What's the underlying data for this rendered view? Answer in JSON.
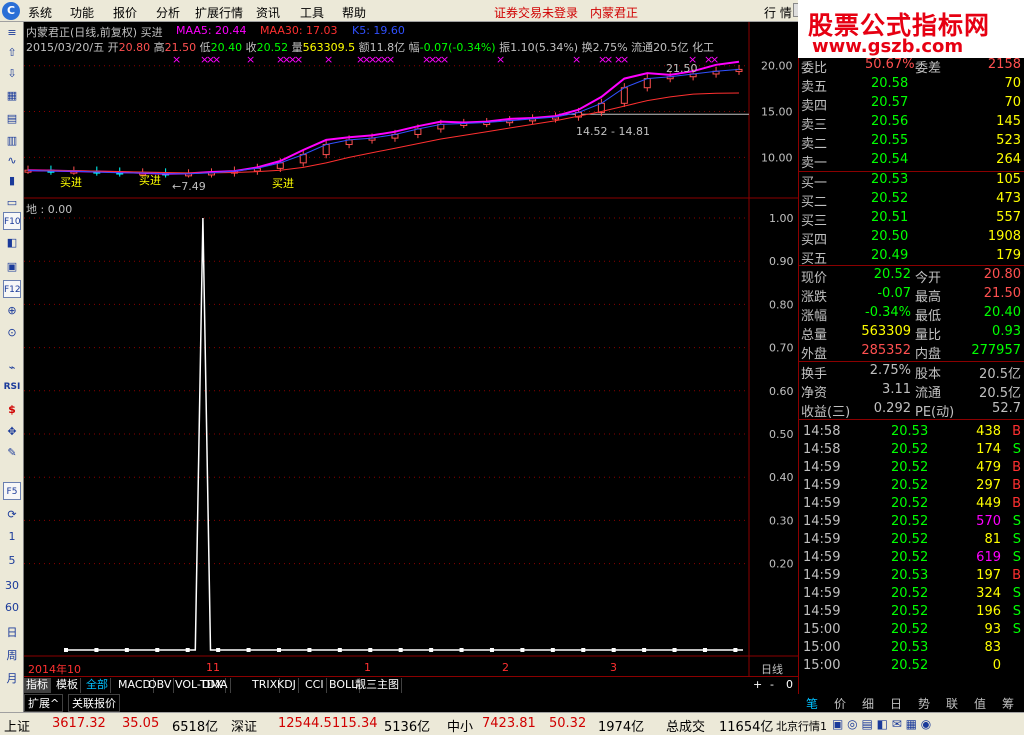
{
  "menu": {
    "items": [
      "系统",
      "功能",
      "报价",
      "分析",
      "扩展行情",
      "资讯",
      "工具",
      "帮助"
    ],
    "notice": "证券交易未登录",
    "stock": "内蒙君正",
    "right_label": "行 情"
  },
  "logo": {
    "title": "股票公式指标网",
    "url": "www.gszb.com"
  },
  "chart_header": {
    "title": "内蒙君正(日线,前复权) 买进",
    "ma5_label": "MAA5: 20.44",
    "ma30_label": "MAA30: 17.03",
    "k5_label": "K5: 19.60",
    "info_date": "2015/03/20/五",
    "open_label": "开",
    "open": "20.80",
    "high_label": "高",
    "high": "21.50",
    "low_label": "低",
    "low": "20.40",
    "close_label": "收",
    "close": "20.52",
    "vol_label": "量",
    "vol": "563309.5",
    "amount_label": "额",
    "amount": "11.8亿",
    "range_label": "幅",
    "range": "-0.07(-0.34%)",
    "amp_label": "振",
    "amp": "1.10(5.34%)",
    "turnover_label": "换",
    "turnover": "2.75%",
    "float_label": "流通",
    "float": "20.5亿",
    "industry": "化工"
  },
  "chart_annotations": {
    "buy1": "买进",
    "buy2": "买进",
    "buy3": "买进",
    "low_price": "7.49",
    "high_price": "21.50",
    "range": "14.52 - 14.81"
  },
  "sub_header": "地 : 0.00",
  "x_axis": [
    "2014年10",
    "11",
    "1",
    "2",
    "3"
  ],
  "x_axis_right": "日线",
  "chart_data": [
    {
      "type": "line",
      "title": "内蒙君正(日线,前复权)",
      "y_ticks": [
        "20.00",
        "15.00",
        "10.00"
      ],
      "ylim": [
        6,
        21.5
      ],
      "series": [
        {
          "name": "MAA5",
          "color": "#ff00ff",
          "values": [
            8.6,
            8.55,
            8.5,
            8.45,
            8.4,
            8.3,
            8.2,
            8.25,
            8.4,
            8.5,
            8.9,
            9.6,
            10.8,
            11.9,
            12.2,
            12.4,
            12.8,
            13.4,
            13.9,
            13.8,
            13.9,
            14.2,
            14.3,
            14.5,
            15.2,
            16.6,
            18.6,
            19.2,
            19.0,
            19.4,
            20.1,
            20.44
          ]
        },
        {
          "name": "MAA30",
          "color": "#ff3030",
          "values": [
            8.6,
            8.58,
            8.55,
            8.5,
            8.45,
            8.4,
            8.35,
            8.3,
            8.3,
            8.35,
            8.45,
            8.6,
            8.9,
            9.4,
            10.0,
            10.5,
            11.0,
            11.5,
            12.0,
            12.4,
            12.8,
            13.2,
            13.6,
            14.0,
            14.5,
            15.0,
            15.6,
            16.2,
            16.6,
            16.9,
            17.0,
            17.03
          ]
        },
        {
          "name": "K5",
          "color": "#3050ff",
          "values": [
            8.6,
            8.5,
            8.5,
            8.4,
            8.3,
            8.3,
            8.2,
            8.2,
            8.3,
            8.5,
            8.8,
            9.4,
            10.3,
            11.4,
            11.9,
            12.1,
            12.5,
            13.1,
            13.6,
            13.7,
            13.8,
            14.0,
            14.2,
            14.4,
            14.9,
            15.9,
            17.6,
            18.6,
            18.8,
            19.1,
            19.4,
            19.6
          ]
        }
      ]
    },
    {
      "type": "line",
      "title": "地",
      "y_ticks": [
        "1.00",
        "0.90",
        "0.80",
        "0.70",
        "0.60",
        "0.50",
        "0.40",
        "0.30",
        "0.20"
      ],
      "ylim": [
        0,
        1
      ],
      "series": [
        {
          "name": "地",
          "color": "#ffffff",
          "values": [
            0,
            0,
            0,
            0,
            0,
            0,
            0,
            0,
            0,
            0,
            0,
            0,
            0,
            0,
            0,
            0,
            0,
            0,
            1,
            0,
            0,
            0,
            0,
            0,
            0,
            0,
            0,
            0,
            0,
            0,
            0,
            0,
            0,
            0,
            0,
            0,
            0,
            0,
            0,
            0,
            0,
            0,
            0,
            0,
            0,
            0,
            0,
            0,
            0,
            0,
            0,
            0,
            0,
            0,
            0,
            0,
            0,
            0,
            0,
            0,
            0,
            0,
            0,
            0,
            0,
            0,
            0,
            0,
            0,
            0,
            0,
            0,
            0,
            0,
            0,
            0,
            0,
            0,
            0,
            0,
            0,
            0,
            0,
            0,
            0,
            0,
            0,
            0,
            0,
            0
          ]
        }
      ]
    }
  ],
  "quote": {
    "top_label": "委比",
    "top_value": "50.67%",
    "top_label2": "委差",
    "top_value2": "2158",
    "asks": [
      {
        "label": "卖五",
        "price": "20.58",
        "vol": "70"
      },
      {
        "label": "卖四",
        "price": "20.57",
        "vol": "70"
      },
      {
        "label": "卖三",
        "price": "20.56",
        "vol": "145"
      },
      {
        "label": "卖二",
        "price": "20.55",
        "vol": "523"
      },
      {
        "label": "卖一",
        "price": "20.54",
        "vol": "264"
      }
    ],
    "bids": [
      {
        "label": "买一",
        "price": "20.53",
        "vol": "105"
      },
      {
        "label": "买二",
        "price": "20.52",
        "vol": "473"
      },
      {
        "label": "买三",
        "price": "20.51",
        "vol": "557"
      },
      {
        "label": "买四",
        "price": "20.50",
        "vol": "1908"
      },
      {
        "label": "买五",
        "price": "20.49",
        "vol": "179"
      }
    ],
    "stats": [
      {
        "l1": "现价",
        "v1": "20.52",
        "c1": "#00ff00",
        "l2": "今开",
        "v2": "20.80",
        "c2": "#ff5050"
      },
      {
        "l1": "涨跌",
        "v1": "-0.07",
        "c1": "#00ff00",
        "l2": "最高",
        "v2": "21.50",
        "c2": "#ff5050"
      },
      {
        "l1": "涨幅",
        "v1": "-0.34%",
        "c1": "#00ff00",
        "l2": "最低",
        "v2": "20.40",
        "c2": "#00ff00"
      },
      {
        "l1": "总量",
        "v1": "563309",
        "c1": "#ffff00",
        "l2": "量比",
        "v2": "0.93",
        "c2": "#00ff00"
      },
      {
        "l1": "外盘",
        "v1": "285352",
        "c1": "#ff5050",
        "l2": "内盘",
        "v2": "277957",
        "c2": "#00ff00"
      }
    ],
    "fundamentals": [
      {
        "l1": "换手",
        "v1": "2.75%",
        "l2": "股本",
        "v2": "20.5亿"
      },
      {
        "l1": "净资",
        "v1": "3.11",
        "l2": "流通",
        "v2": "20.5亿"
      },
      {
        "l1": "收益(三)",
        "v1": "0.292",
        "l2": "PE(动)",
        "v2": "52.7"
      }
    ],
    "ticks": [
      {
        "time": "14:58",
        "price": "20.53",
        "vol": "438",
        "side": "B",
        "vcolor": "#ffff00"
      },
      {
        "time": "14:58",
        "price": "20.52",
        "vol": "174",
        "side": "S",
        "vcolor": "#ffff00"
      },
      {
        "time": "14:59",
        "price": "20.52",
        "vol": "479",
        "side": "B",
        "vcolor": "#ffff00"
      },
      {
        "time": "14:59",
        "price": "20.52",
        "vol": "297",
        "side": "B",
        "vcolor": "#ffff00"
      },
      {
        "time": "14:59",
        "price": "20.52",
        "vol": "449",
        "side": "B",
        "vcolor": "#ffff00"
      },
      {
        "time": "14:59",
        "price": "20.52",
        "vol": "570",
        "side": "S",
        "vcolor": "#ff00ff"
      },
      {
        "time": "14:59",
        "price": "20.52",
        "vol": "81",
        "side": "S",
        "vcolor": "#ffff00"
      },
      {
        "time": "14:59",
        "price": "20.52",
        "vol": "619",
        "side": "S",
        "vcolor": "#ff00ff"
      },
      {
        "time": "14:59",
        "price": "20.53",
        "vol": "197",
        "side": "B",
        "vcolor": "#ffff00"
      },
      {
        "time": "14:59",
        "price": "20.52",
        "vol": "324",
        "side": "S",
        "vcolor": "#ffff00"
      },
      {
        "time": "14:59",
        "price": "20.52",
        "vol": "196",
        "side": "S",
        "vcolor": "#ffff00"
      },
      {
        "time": "15:00",
        "price": "20.52",
        "vol": "93",
        "side": "S",
        "vcolor": "#ffff00"
      },
      {
        "time": "15:00",
        "price": "20.53",
        "vol": "83",
        "side": "",
        "vcolor": "#ffff00"
      },
      {
        "time": "15:00",
        "price": "20.52",
        "vol": "0",
        "side": "",
        "vcolor": "#ffff00"
      }
    ]
  },
  "right_tabs": [
    "笔",
    "价",
    "细",
    "日",
    "势",
    "联",
    "值",
    "筹"
  ],
  "indicator_tabs": [
    "指标",
    "模板",
    "全部",
    "MACD",
    "OBV",
    "VOL-TDX",
    "DMA",
    "TRIX",
    "KDJ",
    "CCI",
    "BOLL",
    "靓三主图"
  ],
  "indicator_ctrl": [
    "+",
    "-",
    "0"
  ],
  "sub_tabs": [
    "扩展^",
    "关联报价"
  ],
  "left_tools": [
    "≡",
    "⇧",
    "⇩",
    "▦",
    "▤",
    "▥",
    "∿",
    "▮",
    "▭",
    "F10",
    "◧",
    "▣",
    "F12",
    "⊕",
    "⊙",
    "⌁",
    "RSI",
    "$",
    "✥",
    "✎",
    "F5",
    "⟳"
  ],
  "periods": [
    "1",
    "5",
    "30",
    "60",
    "日",
    "周",
    "月"
  ],
  "status": [
    {
      "label": "上证",
      "index": "3617.32",
      "chg": "35.05",
      "amt": "6518亿"
    },
    {
      "label": "深证",
      "index": "12544.5",
      "chg": "115.34",
      "amt": "5136亿"
    },
    {
      "label": "中小",
      "index": "7423.81",
      "chg": "50.32",
      "amt": "1974亿"
    }
  ],
  "total_label": "总成交",
  "total_value": "11654亿",
  "market": "北京行情1"
}
